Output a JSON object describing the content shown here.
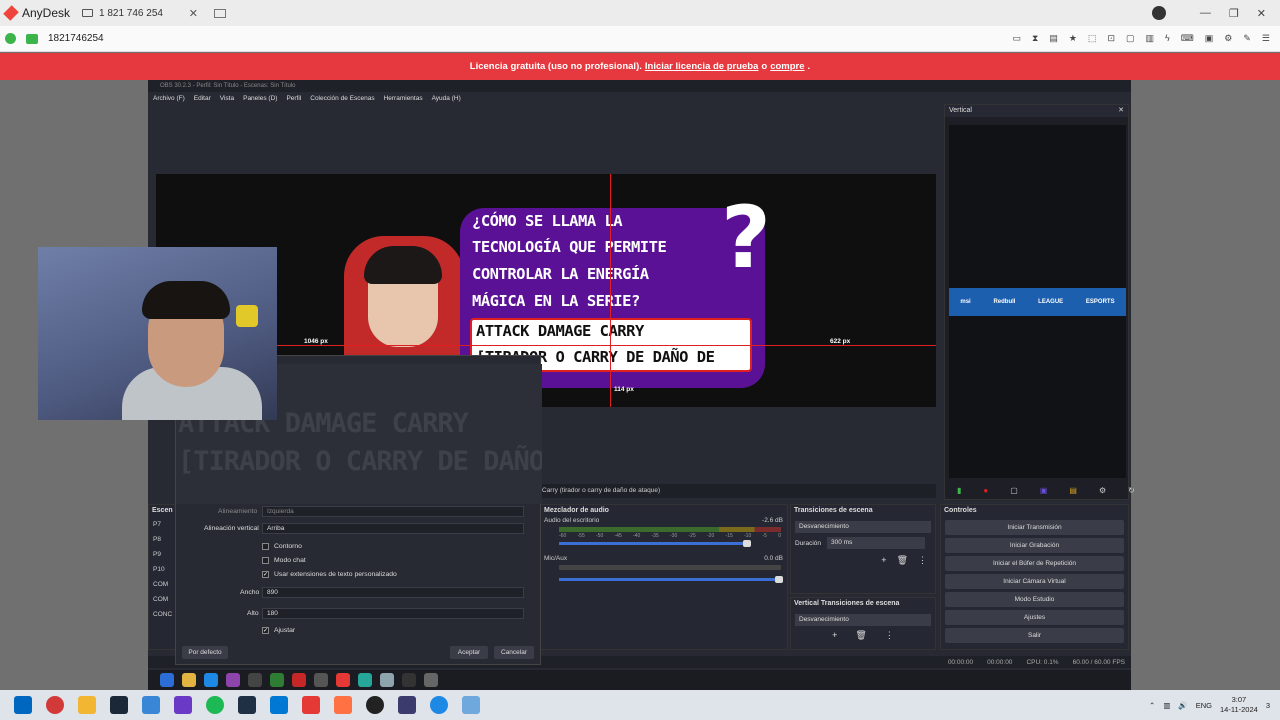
{
  "anydesk": {
    "app_name": "AnyDesk",
    "tab_label": "1 821 746 254",
    "address": "1821746254",
    "banner": {
      "text": "Licencia gratuita (uso no profesional).",
      "link1": "Iniciar licencia de prueba",
      "mid": "o",
      "link2": "compre",
      "end": "."
    }
  },
  "obs": {
    "title": "OBS 30.2.3 - Perfil: Sin Título - Escenas: Sin Título",
    "menu": [
      "Archivo (F)",
      "Editar",
      "Vista",
      "Paneles (D)",
      "Perfil",
      "Colección de Escenas",
      "Herramientas",
      "Ayuda (H)"
    ],
    "preview": {
      "question_lines": [
        "¿CÓMO SE LLAMA LA",
        "TECNOLOGÍA QUE PERMITE",
        "CONTROLAR LA ENERGÍA",
        "MÁGICA EN LA SERIE?"
      ],
      "answer_lines": [
        "ATTACK DAMAGE CARRY",
        "[TIRADOR O CARRY DE DAÑO DE"
      ],
      "qmark": "?",
      "dim_left": "1046 px",
      "dim_right": "622 px",
      "dim_bottom": "114 px"
    },
    "vertical": {
      "title": "Vertical",
      "sponsors": [
        "msi",
        "Redbull",
        "LEAGUE",
        "ESPORTS"
      ]
    },
    "source_bar": "Carry (tirador o carry de daño de ataque)",
    "scenes_header": "Escen",
    "scenes": [
      "P7",
      "P8",
      "P9",
      "P10",
      "COM",
      "COM",
      "CONC"
    ],
    "mixer": {
      "title": "Mezclador de audio",
      "tracks": [
        {
          "name": "Audio del escritorio",
          "db": "-2.6 dB"
        },
        {
          "name": "Mic/Aux",
          "db": "0.0 dB"
        }
      ],
      "scale": [
        "-60",
        "-55",
        "-50",
        "-45",
        "-40",
        "-35",
        "-30",
        "-25",
        "-20",
        "-15",
        "-10",
        "-5",
        "0"
      ]
    },
    "transitions": {
      "title": "Transiciones de escena",
      "selected": "Desvanecimiento",
      "duration_label": "Duración",
      "duration": "300 ms"
    },
    "vtransitions": {
      "title": "Vertical Transiciones de escena",
      "selected": "Desvanecimiento"
    },
    "controls": {
      "title": "Controles",
      "buttons": [
        "Iniciar Transmisión",
        "Iniciar Grabación",
        "Iniciar el Búfer de Repetición",
        "Iniciar Cámara Virtual",
        "Modo Estudio",
        "Ajustes",
        "Salir"
      ]
    },
    "status": {
      "t1": "00:00:00",
      "t2": "00:00:00",
      "cpu": "CPU: 0.1%",
      "fps": "60.00 / 60.00 FPS"
    }
  },
  "props": {
    "ghost_lines": [
      "ATTACK DAMAGE CARRY",
      "[TIRADOR O CARRY DE DAÑO DE"
    ],
    "partial_label": "Alineamiento",
    "partial_value": "Izquierda",
    "valign_label": "Alineación vertical",
    "valign_value": "Arriba",
    "outline": "Contorno",
    "chat": "Modo chat",
    "custom_ext": "Usar extensiones de texto personalizado",
    "width_label": "Ancho",
    "width_value": "890",
    "height_label": "Alto",
    "height_value": "180",
    "wrap": "Ajustar",
    "defaults_btn": "Por defecto",
    "accept_btn": "Aceptar",
    "cancel_btn": "Cancelar"
  },
  "tray": {
    "lang1": "ESP",
    "lang2": "ENG",
    "time": "3:07",
    "date": "14-11-2024",
    "notif": "3"
  }
}
